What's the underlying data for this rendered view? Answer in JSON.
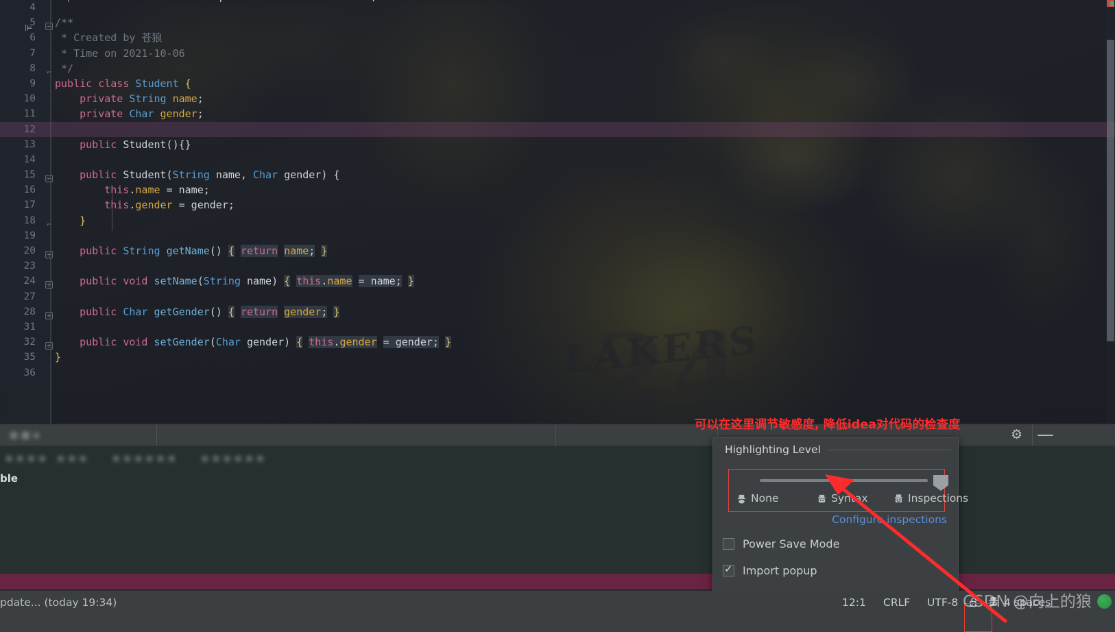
{
  "editor": {
    "font_note": "IntelliJ IDEA dark editor with photo background",
    "caret_line": 12,
    "lines": [
      {
        "num": "4",
        "fold": "",
        "html_id": "blank"
      },
      {
        "num": "5",
        "fold": "minus",
        "html_id": "doc-open"
      },
      {
        "num": "6",
        "fold": "",
        "html_id": "doc-created"
      },
      {
        "num": "7",
        "fold": "",
        "html_id": "doc-time"
      },
      {
        "num": "8",
        "fold": "end",
        "html_id": "doc-close"
      },
      {
        "num": "9",
        "fold": "",
        "html_id": "class-decl"
      },
      {
        "num": "10",
        "fold": "",
        "html_id": "field-name"
      },
      {
        "num": "11",
        "fold": "",
        "html_id": "field-gender"
      },
      {
        "num": "12",
        "fold": "",
        "html_id": "blank2"
      },
      {
        "num": "13",
        "fold": "",
        "html_id": "ctor-empty"
      },
      {
        "num": "14",
        "fold": "",
        "html_id": "blank3"
      },
      {
        "num": "15",
        "fold": "minus",
        "html_id": "ctor-open"
      },
      {
        "num": "16",
        "fold": "",
        "html_id": "this-name"
      },
      {
        "num": "17",
        "fold": "",
        "html_id": "this-gender"
      },
      {
        "num": "18",
        "fold": "end",
        "html_id": "ctor-close"
      },
      {
        "num": "19",
        "fold": "",
        "html_id": "blank4"
      },
      {
        "num": "20",
        "fold": "plus",
        "html_id": "get-name"
      },
      {
        "num": "23",
        "fold": "",
        "html_id": "blank5"
      },
      {
        "num": "24",
        "fold": "plus",
        "html_id": "set-name"
      },
      {
        "num": "27",
        "fold": "",
        "html_id": "blank6"
      },
      {
        "num": "28",
        "fold": "plus",
        "html_id": "get-gender"
      },
      {
        "num": "31",
        "fold": "",
        "html_id": "blank7"
      },
      {
        "num": "32",
        "fold": "plus",
        "html_id": "set-gender"
      },
      {
        "num": "35",
        "fold": "",
        "html_id": "class-close"
      },
      {
        "num": "36",
        "fold": "",
        "html_id": "blank8"
      }
    ],
    "code_text": {
      "import_line": "import com.alibaba.druid.sql.visitor.functions.Char;",
      "doc_open": "/**",
      "doc_created": " * Created by 苍狼",
      "doc_time": " * Time on 2021-10-06",
      "doc_close": " */",
      "class_decl": "public class Student {",
      "field_name": "    private String name;",
      "field_gender": "    private Char gender;",
      "ctor_empty": "    public Student(){}",
      "ctor_open": "    public Student(String name, Char gender) {",
      "this_name": "        this.name = name;",
      "this_gender": "        this.gender = gender;",
      "ctor_close": "    }",
      "get_name": "    public String getName() { return name; }",
      "set_name": "    public void setName(String name) { this.name = name; }",
      "get_gender": "    public Char getGender() { return gender; }",
      "set_gender": "    public void setGender(Char gender) { this.gender = gender; }",
      "class_close": "}"
    }
  },
  "toolwindow": {
    "visible_label": "ble"
  },
  "annotation": {
    "text": "可以在这里调节敏感度, 降低idea对代码的检查度"
  },
  "popup": {
    "title": "Highlighting Level",
    "slider": {
      "levels": [
        "None",
        "Syntax",
        "Inspections"
      ],
      "selected": "Inspections",
      "position_percent": 100
    },
    "configure_link": "Configure inspections",
    "checkboxes": [
      {
        "label": "Power Save Mode",
        "checked": false
      },
      {
        "label": "Import popup",
        "checked": true
      }
    ]
  },
  "toolwindow_controls": {
    "gear": "⚙",
    "minimize": "—"
  },
  "statusbar": {
    "left_text": "pdate... (today 19:34)",
    "caret_position": "12:1",
    "line_separator": "CRLF",
    "encoding": "UTF-8",
    "lock_icon": "🔓",
    "indent": "4 spaces"
  },
  "watermark": {
    "text": "CSDN @向上的狼"
  },
  "colors": {
    "accent_red": "#fd2c2c",
    "link_blue": "#5b8fdb",
    "popup_bg": "#3c4043",
    "editor_bg": "#1e2128",
    "caret_line": "#6b2343",
    "keyword": "#cf6a92",
    "type": "#5a9fd4",
    "field": "#d6a843"
  }
}
